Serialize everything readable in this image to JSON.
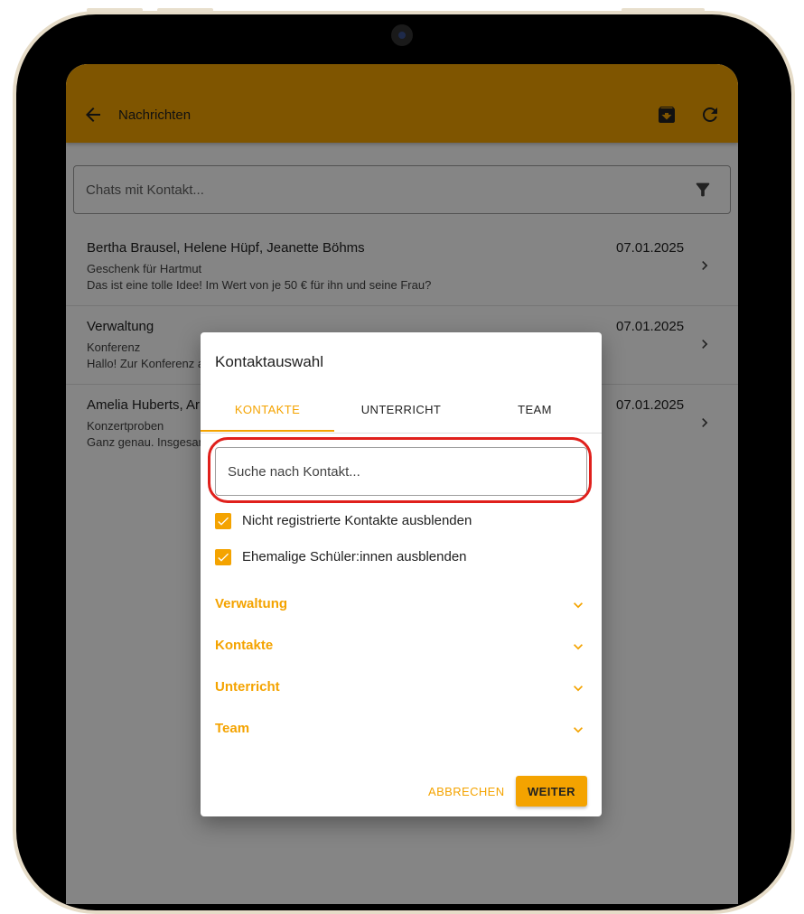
{
  "header": {
    "title": "Nachrichten"
  },
  "filter": {
    "placeholder": "Chats mit Kontakt..."
  },
  "chats": [
    {
      "names": "Bertha Brausel, Helene Hüpf, Jeanette Böhms",
      "subject": "Geschenk für Hartmut",
      "preview": "Das ist eine tolle Idee! Im Wert von je 50 € für ihn und seine Frau?",
      "date": "07.01.2025"
    },
    {
      "names": "Verwaltung",
      "subject": "Konferenz",
      "preview": "Hallo! Zur Konferenz a",
      "date": "07.01.2025"
    },
    {
      "names": "Amelia Huberts, Ar",
      "subject": "Konzertproben",
      "preview": "Ganz genau. Insgesar",
      "date": "07.01.2025"
    }
  ],
  "dialog": {
    "title": "Kontaktauswahl",
    "tabs": [
      "KONTAKTE",
      "UNTERRICHT",
      "TEAM"
    ],
    "search_placeholder": "Suche nach Kontakt...",
    "checkboxes": [
      "Nicht registrierte Kontakte ausblenden",
      "Ehemalige Schüler:innen ausblenden"
    ],
    "groups": [
      "Verwaltung",
      "Kontakte",
      "Unterricht",
      "Team"
    ],
    "cancel_label": "ABBRECHEN",
    "next_label": "WEITER"
  },
  "colors": {
    "accent": "#f4a300",
    "highlight": "#e0201c"
  },
  "icons": [
    "back-arrow-icon",
    "archive-icon",
    "refresh-icon",
    "filter-icon",
    "chevron-right-icon",
    "chevron-down-icon",
    "checkmark-icon"
  ]
}
